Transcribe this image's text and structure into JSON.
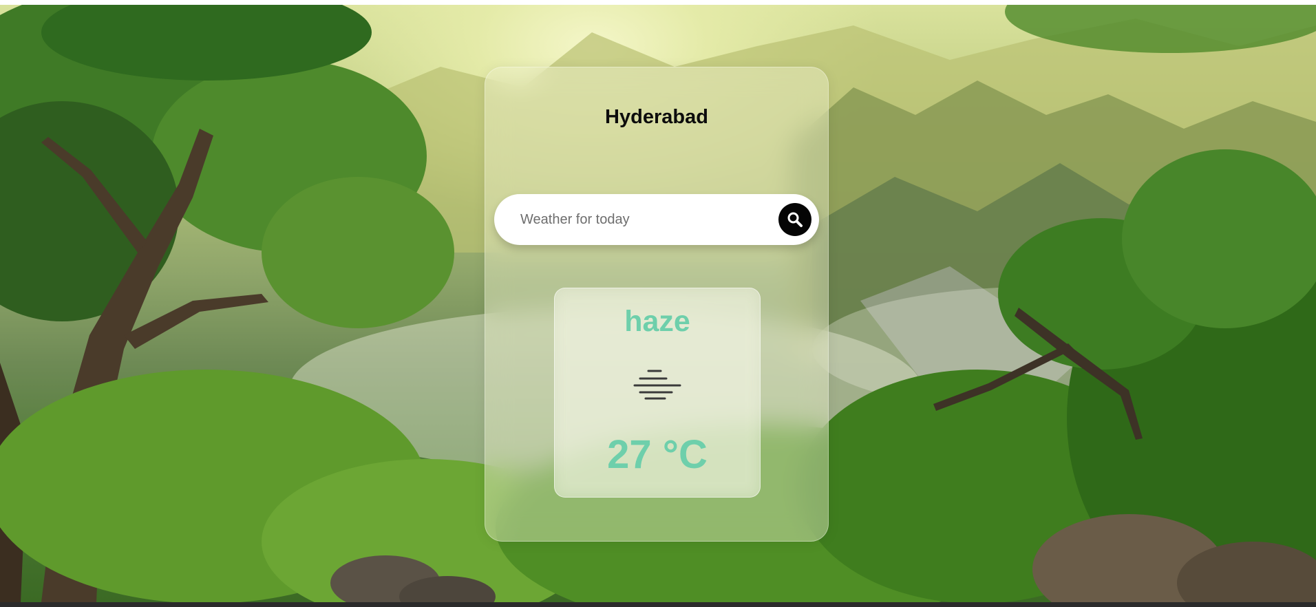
{
  "city": "Hyderabad",
  "search": {
    "placeholder": "Weather for today",
    "value": "",
    "icon": "search-icon"
  },
  "weather": {
    "condition": "haze",
    "icon": "haze-icon",
    "temperature": "27 °C"
  },
  "colors": {
    "accent": "#6ecfab",
    "search_button": "#050505",
    "title": "#0c0c0c"
  }
}
